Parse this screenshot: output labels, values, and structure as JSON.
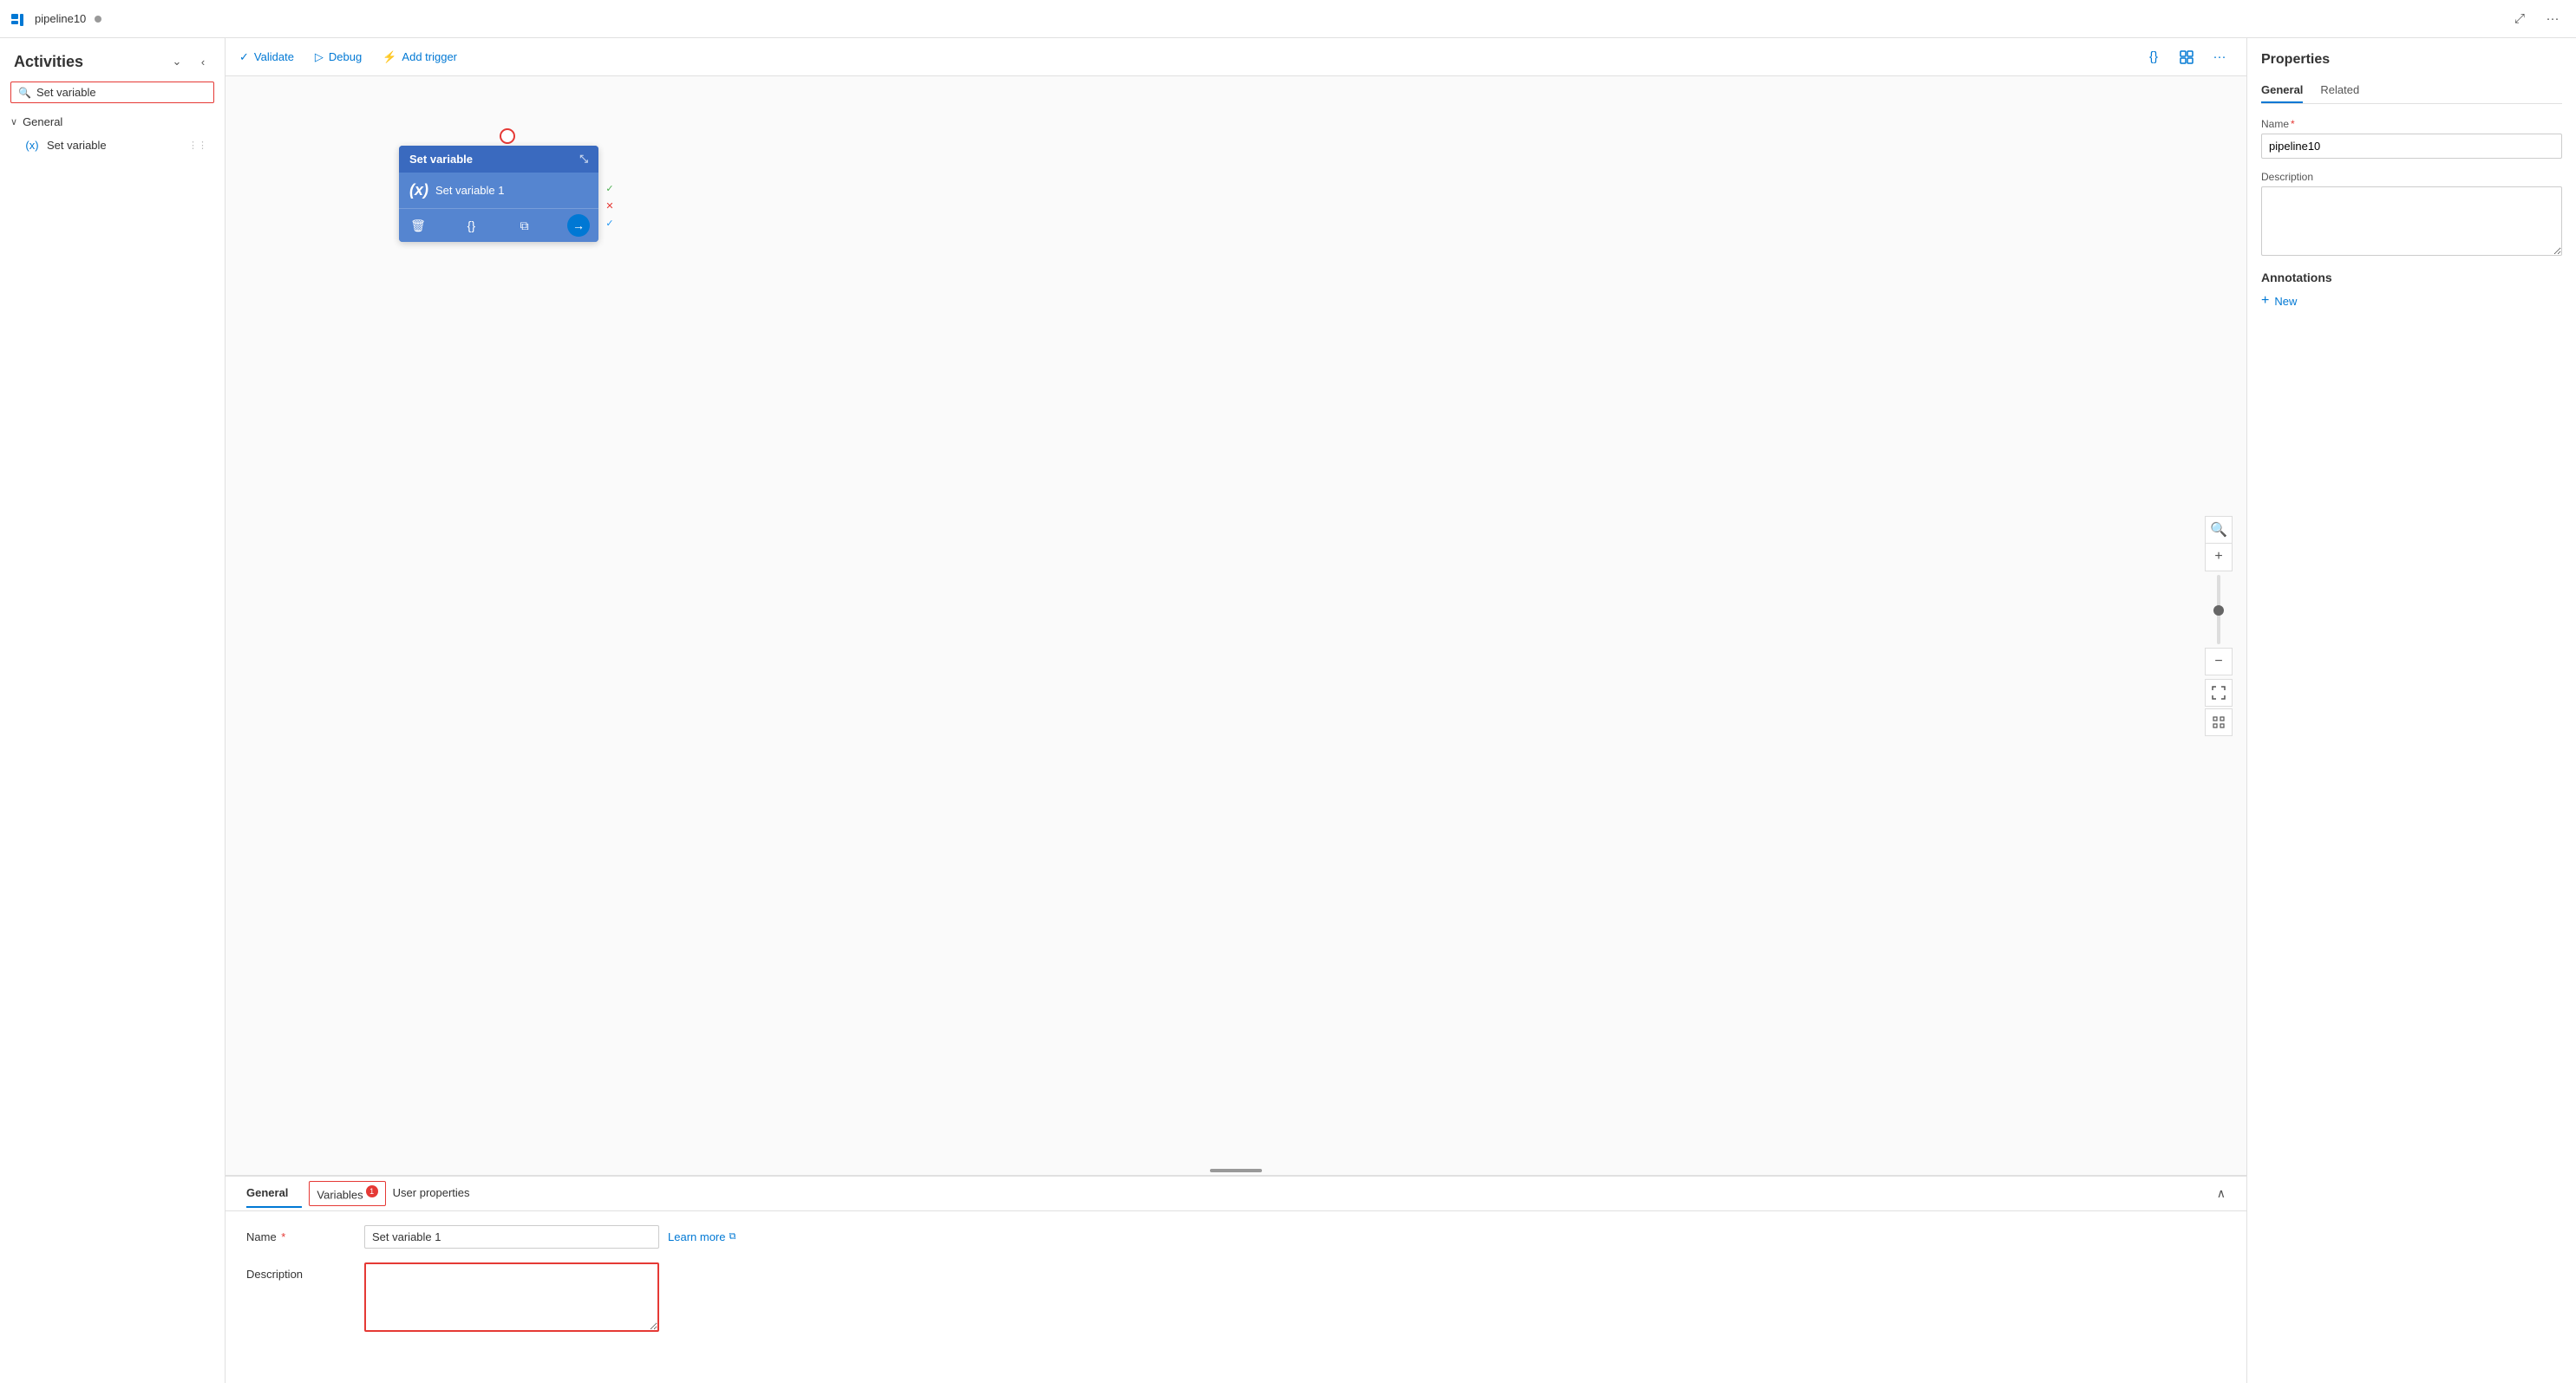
{
  "topbar": {
    "logo_text": "pipeline10",
    "dot_visible": true,
    "expand_icon": "⤢",
    "more_icon": "···"
  },
  "toolbar": {
    "validate_label": "Validate",
    "debug_label": "Debug",
    "add_trigger_label": "Add trigger",
    "json_icon": "{}",
    "layout_icon": "⊞",
    "more_icon": "···"
  },
  "sidebar": {
    "title": "Activities",
    "collapse_icon": "⌄",
    "close_icon": "‹",
    "search_placeholder": "Set variable",
    "search_value": "Set variable",
    "section_general": "General",
    "items": [
      {
        "label": "Set variable",
        "icon": "(x)"
      }
    ]
  },
  "canvas": {
    "node": {
      "header": "Set variable",
      "body_label": "Set variable 1",
      "body_icon": "(x)"
    },
    "controls": {
      "zoom_in": "+",
      "zoom_out": "−",
      "fit": "⊡",
      "grid": "⊞"
    }
  },
  "bottom_panel": {
    "tabs": [
      {
        "label": "General",
        "active": true,
        "badge": null
      },
      {
        "label": "Variables",
        "badge": "1",
        "highlighted": true
      },
      {
        "label": "User properties",
        "badge": null
      }
    ],
    "collapse_icon": "∧",
    "form": {
      "name_label": "Name",
      "name_required": true,
      "name_value": "Set variable 1",
      "name_placeholder": "Set variable 1",
      "learn_more_label": "Learn more",
      "learn_more_icon": "⧉",
      "description_label": "Description",
      "description_value": ""
    }
  },
  "properties": {
    "title": "Properties",
    "tabs": [
      {
        "label": "General",
        "active": true
      },
      {
        "label": "Related",
        "active": false
      }
    ],
    "name_label": "Name",
    "name_required": true,
    "name_value": "pipeline10",
    "description_label": "Description",
    "description_value": "",
    "annotations_label": "Annotations",
    "add_new_label": "New"
  }
}
